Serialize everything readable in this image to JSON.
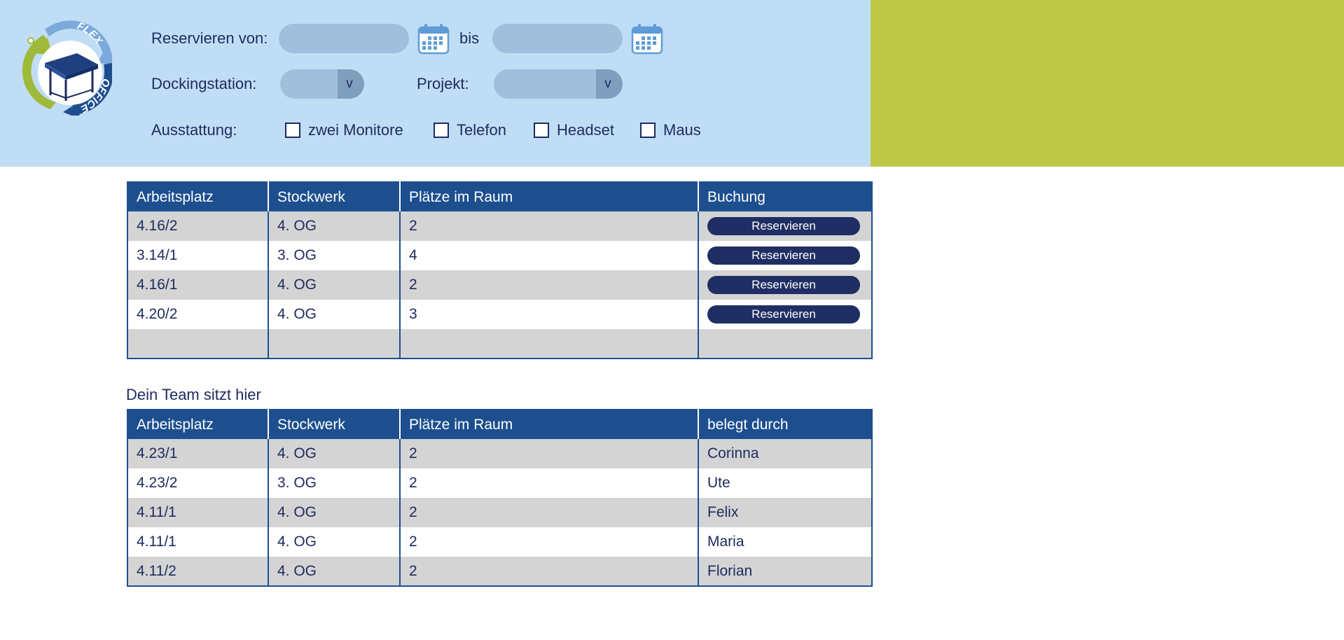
{
  "colors": {
    "header_bg": "#c0ddf6",
    "accent_green": "#bdc847",
    "table_header": "#1d4f8f",
    "button": "#1f2f63",
    "text": "#1d2b5e"
  },
  "logo": {
    "icon": "flex-office-desk-logo",
    "text_top": "FLEX",
    "text_bottom": "OFFICE"
  },
  "filters": {
    "reserve_from_label": "Reservieren von:",
    "date_from_value": "",
    "until_label": "bis",
    "date_to_value": "",
    "calendar_icon": "calendar-icon",
    "docking_label": "Dockingstation:",
    "docking_value": "",
    "project_label": "Projekt:",
    "project_value": "",
    "dropdown_arrow": "v",
    "equipment_label": "Ausstattung:",
    "equipment": [
      {
        "label": "zwei Monitore",
        "checked": false
      },
      {
        "label": "Telefon",
        "checked": false
      },
      {
        "label": "Headset",
        "checked": false
      },
      {
        "label": "Maus",
        "checked": false
      }
    ]
  },
  "results": {
    "columns": [
      "Arbeitsplatz",
      "Stockwerk",
      "Plätze im Raum",
      "Buchung"
    ],
    "rows": [
      {
        "workplace": "4.16/2",
        "floor": "4. OG",
        "seats": "2",
        "action": "Reservieren"
      },
      {
        "workplace": "3.14/1",
        "floor": "3. OG",
        "seats": "4",
        "action": "Reservieren"
      },
      {
        "workplace": "4.16/1",
        "floor": "4. OG",
        "seats": "2",
        "action": "Reservieren"
      },
      {
        "workplace": "4.20/2",
        "floor": "4. OG",
        "seats": "3",
        "action": "Reservieren"
      },
      {
        "workplace": "",
        "floor": "",
        "seats": "",
        "action": ""
      }
    ]
  },
  "team": {
    "title": "Dein Team sitzt hier",
    "columns": [
      "Arbeitsplatz",
      "Stockwerk",
      "Plätze im Raum",
      "belegt durch"
    ],
    "rows": [
      {
        "workplace": "4.23/1",
        "floor": "4. OG",
        "seats": "2",
        "occupied_by": "Corinna"
      },
      {
        "workplace": "4.23/2",
        "floor": "3. OG",
        "seats": "2",
        "occupied_by": "Ute"
      },
      {
        "workplace": "4.11/1",
        "floor": "4. OG",
        "seats": "2",
        "occupied_by": "Felix"
      },
      {
        "workplace": "4.11/1",
        "floor": "4. OG",
        "seats": "2",
        "occupied_by": "Maria"
      },
      {
        "workplace": "4.11/2",
        "floor": "4. OG",
        "seats": "2",
        "occupied_by": "Florian"
      }
    ]
  }
}
